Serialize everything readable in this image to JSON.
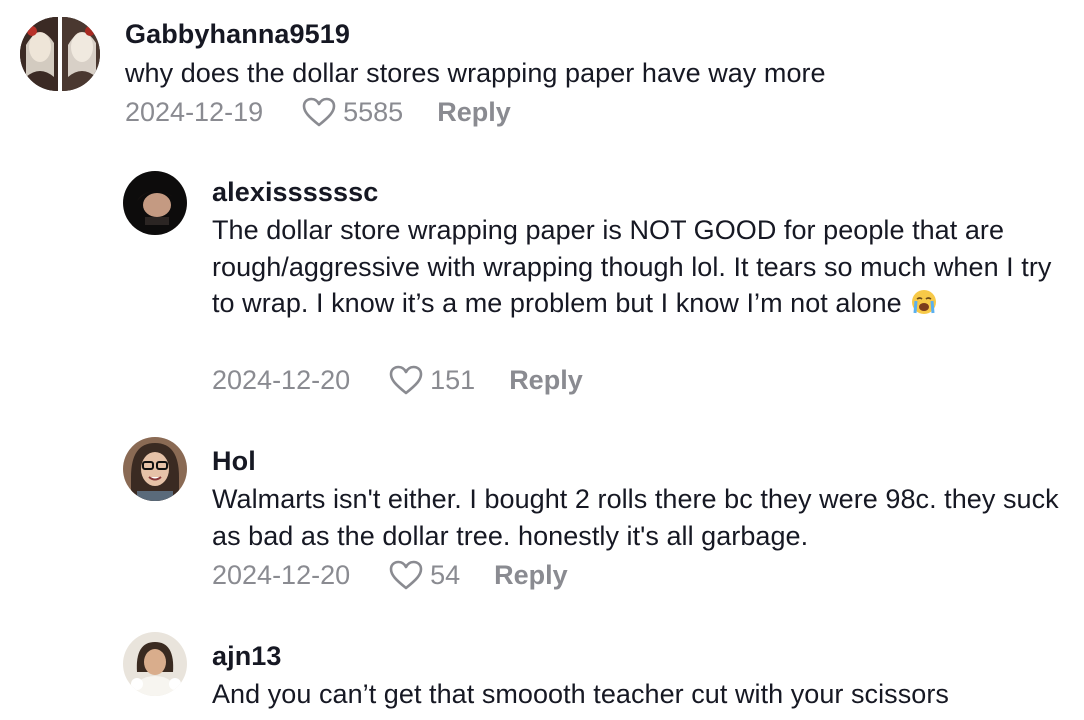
{
  "comments": [
    {
      "username": "Gabbyhanna9519",
      "text": "why does the dollar stores wrapping paper have way more",
      "date": "2024-12-19",
      "likes": "5585",
      "reply_label": "Reply",
      "avatar_icon": "user-avatar-photo"
    },
    {
      "username": "alexissssssc",
      "text": "The dollar store wrapping paper is NOT GOOD for people that are rough/aggressive with wrapping though lol. It tears so much when I try to wrap. I know it’s a me problem but I know I’m not alone",
      "emoji": "loudly-crying-face-emoji",
      "date": "2024-12-20",
      "likes": "151",
      "reply_label": "Reply",
      "avatar_icon": "user-avatar-photo"
    },
    {
      "username": "Hol",
      "text": "Walmarts isn't either. I bought 2 rolls there bc they were 98c. they suck as bad as the dollar tree. honestly it's all garbage.",
      "date": "2024-12-20",
      "likes": "54",
      "reply_label": "Reply",
      "avatar_icon": "user-avatar-photo"
    },
    {
      "username": "ajn13",
      "text": "And you can’t get that smoooth teacher cut with your scissors",
      "avatar_icon": "user-avatar-photo"
    }
  ],
  "icons": {
    "like": "heart-outline-icon"
  },
  "colors": {
    "text_primary": "#161823",
    "text_secondary": "#8a8b91",
    "background": "#ffffff"
  }
}
